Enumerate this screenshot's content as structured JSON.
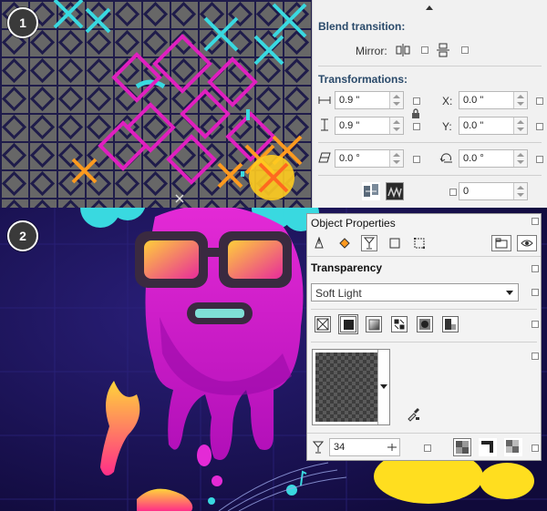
{
  "panel1": {
    "step": "1",
    "blend": {
      "title": "Blend transition:",
      "mirror_label": "Mirror:"
    },
    "transformations": {
      "title": "Transformations:",
      "width": "0.9 \"",
      "height": "0.9 \"",
      "x_label": "X:",
      "x_value": "0.0 \"",
      "y_label": "Y:",
      "y_value": "0.0 \"",
      "skew": "0.0 °",
      "rotate": "0.0 °",
      "count": "0"
    }
  },
  "panel2": {
    "step": "2",
    "object_properties": {
      "title": "Object Properties",
      "section": "Transparency",
      "merge_mode": "Soft Light",
      "opacity": "34"
    }
  },
  "colors": {
    "canvas_gray": "#676767",
    "grid_navy": "#1f1c4a",
    "cyan": "#39d9e0",
    "magenta": "#e01fbf",
    "orange": "#ff9a1f",
    "night": "#16104a",
    "pink_body": "#d81fd0"
  }
}
